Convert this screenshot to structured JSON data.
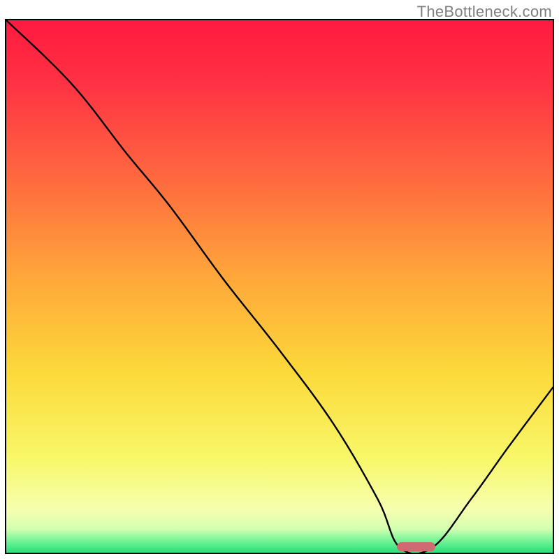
{
  "watermark": "TheBottleneck.com",
  "chart_data": {
    "type": "line",
    "title": "",
    "xlabel": "",
    "ylabel": "",
    "xlim": [
      0,
      100
    ],
    "ylim": [
      0,
      100
    ],
    "note": "Bottleneck curve on rainbow gradient. y ≈ bottleneck % (100 top, 0 bottom). Minimum ≈ 0 around x 72–78.",
    "series": [
      {
        "name": "bottleneck-curve",
        "x": [
          0,
          12,
          22,
          30,
          40,
          50,
          60,
          68,
          72,
          78,
          85,
          92,
          100
        ],
        "values": [
          100,
          88,
          75,
          65,
          51,
          38,
          24,
          10,
          1,
          1,
          10,
          20,
          31
        ]
      }
    ],
    "marker": {
      "x_start": 72,
      "x_end": 78,
      "y": 1,
      "color": "#cf6a72"
    },
    "background_gradient": {
      "stops": [
        {
          "pos": 0.0,
          "color": "#ff1a3f"
        },
        {
          "pos": 0.12,
          "color": "#ff3244"
        },
        {
          "pos": 0.3,
          "color": "#ff6a3f"
        },
        {
          "pos": 0.48,
          "color": "#ffa63a"
        },
        {
          "pos": 0.66,
          "color": "#fcd93a"
        },
        {
          "pos": 0.82,
          "color": "#f8f768"
        },
        {
          "pos": 0.92,
          "color": "#f6ffb0"
        },
        {
          "pos": 0.955,
          "color": "#d4ffb0"
        },
        {
          "pos": 0.975,
          "color": "#7ef59a"
        },
        {
          "pos": 1.0,
          "color": "#24e07a"
        }
      ]
    }
  }
}
